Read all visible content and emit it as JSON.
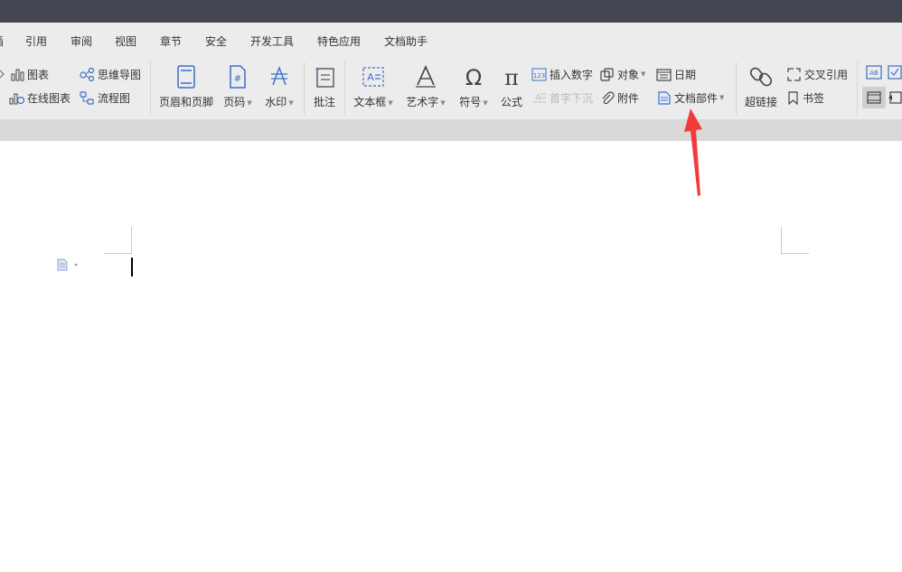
{
  "menu_tabs": {
    "partial": "插",
    "cite": "引用",
    "review": "审阅",
    "view": "视图",
    "chapter": "章节",
    "security": "安全",
    "dev_tools": "开发工具",
    "special": "特色应用",
    "assistant": "文档助手"
  },
  "ribbon": {
    "chart": "图表",
    "mindmap": "思维导图",
    "online_chart": "在线图表",
    "flowchart": "流程图",
    "header_footer": "页眉和页脚",
    "page_number": "页码",
    "watermark": "水印",
    "comment": "批注",
    "textbox": "文本框",
    "wordart": "艺术字",
    "symbol": "符号",
    "formula": "公式",
    "insert_number": "插入数字",
    "drop_cap": "首字下沉",
    "object": "对象",
    "attachment": "附件",
    "date": "日期",
    "doc_parts": "文档部件",
    "hyperlink": "超链接",
    "cross_ref": "交叉引用",
    "bookmark": "书签"
  },
  "colors": {
    "titlebar": "#434650",
    "ribbon_bg": "#ececec",
    "icon_blue": "#3b6fc6",
    "annotation_arrow": "#f23a3a"
  }
}
